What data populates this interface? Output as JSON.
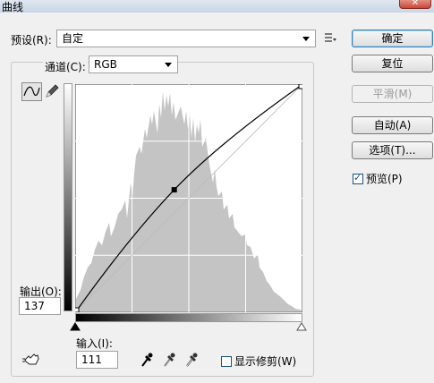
{
  "window": {
    "title": "曲线",
    "close_glyph": "✕"
  },
  "preset": {
    "label": "预设(R):",
    "value": "自定"
  },
  "channel": {
    "label": "通道(C):",
    "value": "RGB"
  },
  "buttons": {
    "ok": "确定",
    "reset": "复位",
    "smooth": "平滑(M)",
    "auto": "自动(A)",
    "options": "选项(T)..."
  },
  "preview": {
    "label": "预览(P)",
    "checked": true
  },
  "output": {
    "label": "输出(O):",
    "value": "137"
  },
  "input": {
    "label": "输入(I):",
    "value": "111"
  },
  "show_clipping": {
    "label": "显示修剪(W)",
    "checked": false
  },
  "icons": [
    "preset-menu-icon",
    "curve-tool-icon",
    "pencil-tool-icon",
    "target-adjust-icon",
    "black-eyedropper-icon",
    "gray-eyedropper-icon",
    "white-eyedropper-icon"
  ],
  "curve": {
    "control_point": {
      "input": 111,
      "output": 137
    },
    "range": [
      0,
      255
    ]
  },
  "colors": {
    "histogram": "#c4c4c4",
    "curve": "#000000",
    "default_button_border": "#3c7fb1"
  }
}
